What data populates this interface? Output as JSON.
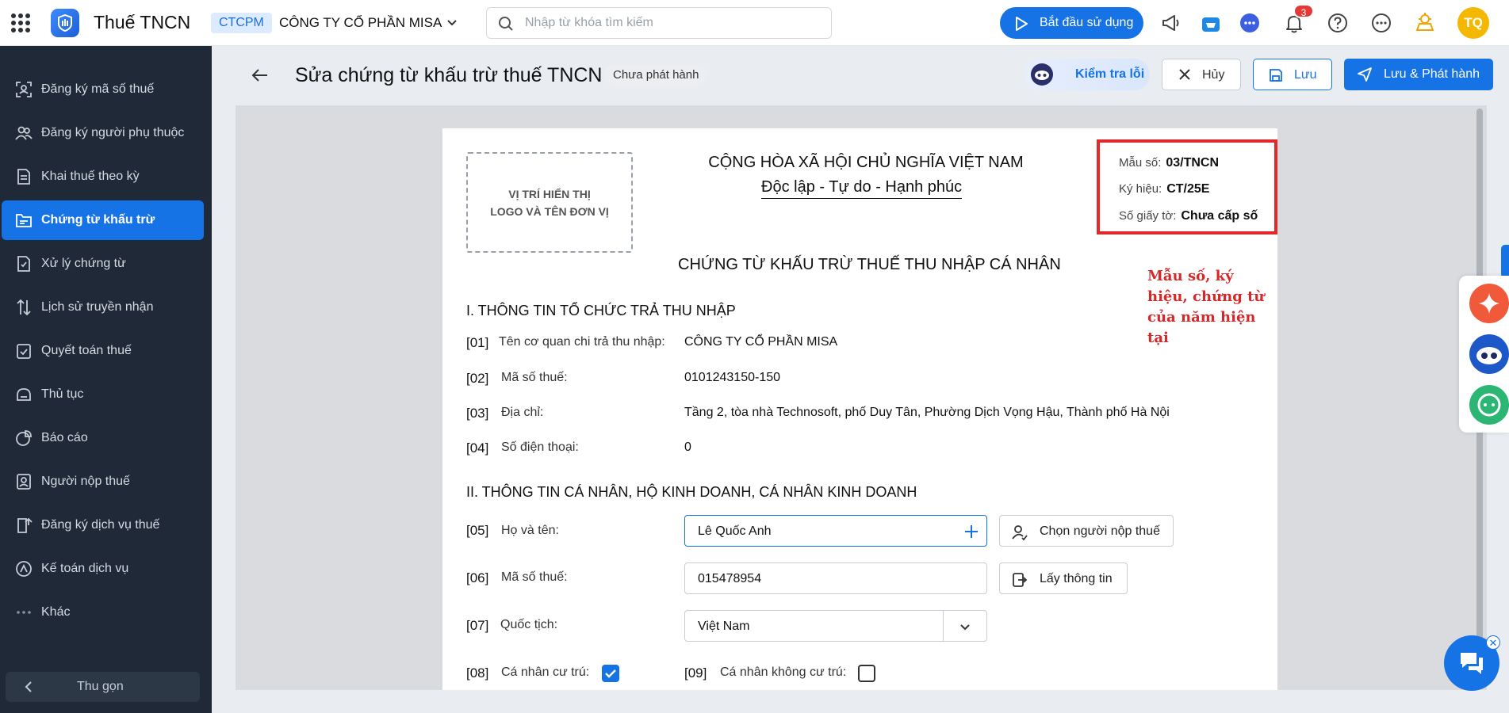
{
  "app": {
    "title": "Thuế TNCN"
  },
  "org": {
    "code": "CTCPM",
    "name": "CÔNG TY CỔ PHẦN MISA"
  },
  "search": {
    "placeholder": "Nhập từ khóa tìm kiếm"
  },
  "topbar": {
    "start_label": "Bắt đầu sử dụng",
    "notification_count": "3",
    "avatar_initials": "TQ"
  },
  "sidebar": {
    "items": [
      {
        "label": "Đăng ký mã số thuế",
        "icon": "scan-id-icon"
      },
      {
        "label": "Đăng ký người phụ thuộc",
        "icon": "people-icon"
      },
      {
        "label": "Khai thuế theo kỳ",
        "icon": "document-icon"
      },
      {
        "label": "Chứng từ khấu trừ",
        "icon": "voucher-icon",
        "active": true
      },
      {
        "label": "Xử lý chứng từ",
        "icon": "file-process-icon"
      },
      {
        "label": "Lịch sử truyền nhận",
        "icon": "transfer-icon"
      },
      {
        "label": "Quyết toán thuế",
        "icon": "settlement-icon"
      },
      {
        "label": "Thủ tục",
        "icon": "procedure-icon"
      },
      {
        "label": "Báo cáo",
        "icon": "pie-chart-icon"
      },
      {
        "label": "Người nộp thuế",
        "icon": "taxpayer-icon"
      },
      {
        "label": "Đăng ký dịch vụ thuế",
        "icon": "service-register-icon"
      },
      {
        "label": "Kế toán dịch vụ",
        "icon": "accounting-icon"
      },
      {
        "label": "Khác",
        "icon": "more-dots-icon"
      }
    ],
    "collapse_label": "Thu gọn"
  },
  "header": {
    "title": "Sửa chứng từ khấu trừ thuế TNCN",
    "status": "Chưa phát hành",
    "check_label": "Kiểm tra lỗi",
    "cancel_label": "Hủy",
    "save_label": "Lưu",
    "save_publish_label": "Lưu & Phát hành"
  },
  "document": {
    "logo_placeholder_line1": "VỊ TRÍ HIỂN THỊ",
    "logo_placeholder_line2": "LOGO VÀ TÊN ĐƠN VỊ",
    "nation": "CỘNG HÒA XÃ HỘI CHỦ NGHĨA VIỆT NAM",
    "motto": "Độc lập - Tự do - Hạnh phúc",
    "form_no_label": "Mẫu số:",
    "form_no": "03/TNCN",
    "symbol_label": "Ký hiệu:",
    "symbol": "CT/25E",
    "doc_no_label": "Số giấy tờ:",
    "doc_no": "Chưa cấp số",
    "title": "CHỨNG TỪ KHẤU TRỪ THUẾ THU NHẬP CÁ NHÂN",
    "annotation": "Mẫu số, ký hiệu, chứng từ của năm hiện tại",
    "section1": "I. THÔNG TIN TỔ CHỨC TRẢ THU NHẬP",
    "section2": "II. THÔNG TIN CÁ NHÂN, HỘ KINH DOANH, CÁ NHÂN KINH DOANH",
    "fields": {
      "f01": {
        "code": "[01]",
        "label": "Tên cơ quan chi trả thu nhập:",
        "value": "CÔNG TY CỔ PHẦN MISA"
      },
      "f02": {
        "code": "[02]",
        "label": "Mã số thuế:",
        "value": "0101243150-150"
      },
      "f03": {
        "code": "[03]",
        "label": "Địa chỉ:",
        "value": "Tầng 2, tòa nhà Technosoft, phố Duy Tân, Phường Dịch Vọng Hậu, Thành phố Hà Nội"
      },
      "f04": {
        "code": "[04]",
        "label": "Số điện thoại:",
        "value": "0"
      },
      "f05": {
        "code": "[05]",
        "label": "Họ và tên:",
        "value": "Lê Quốc Anh",
        "action": "Chọn người nộp thuế"
      },
      "f06": {
        "code": "[06]",
        "label": "Mã số thuế:",
        "value": "015478954",
        "action": "Lấy thông tin"
      },
      "f07": {
        "code": "[07]",
        "label": "Quốc tịch:",
        "value": "Việt Nam"
      },
      "f08": {
        "code": "[08]",
        "label": "Cá nhân cư trú:",
        "checked": true
      },
      "f09": {
        "code": "[09]",
        "label": "Cá nhân không cư trú:",
        "checked": false
      }
    }
  },
  "colors": {
    "primary": "#1673e6",
    "sidebar_bg": "#1f2937",
    "highlight_red": "#e12929"
  }
}
